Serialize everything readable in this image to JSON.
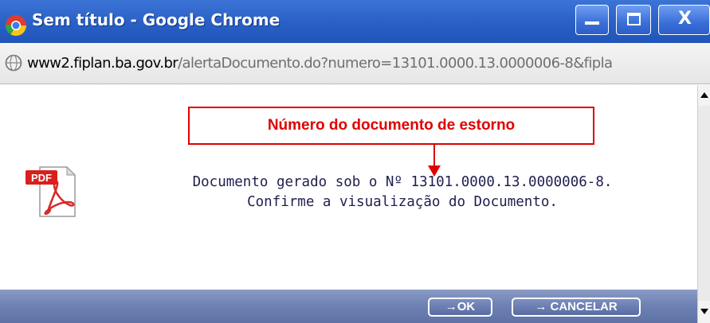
{
  "window": {
    "title": "Sem título - Google Chrome",
    "close_label": "X"
  },
  "address_bar": {
    "host": "www2.fiplan.ba.gov.br",
    "path": "/alertaDocumento.do?numero=13101.0000.13.0000006-8&fipla"
  },
  "annotation": {
    "text": "Número do documento de estorno",
    "color": "#e00000"
  },
  "message": {
    "line1": "Documento gerado sob o Nº 13101.0000.13.0000006-8.",
    "line2": "Confirme a visualização do Documento."
  },
  "pdf_icon": {
    "label": "PDF"
  },
  "footer": {
    "ok_label": "→OK",
    "cancel_label": "→ CANCELAR"
  },
  "colors": {
    "titlebar": "#2d63c8",
    "footer": "#6d80b2",
    "message_text": "#1f1f4f"
  }
}
